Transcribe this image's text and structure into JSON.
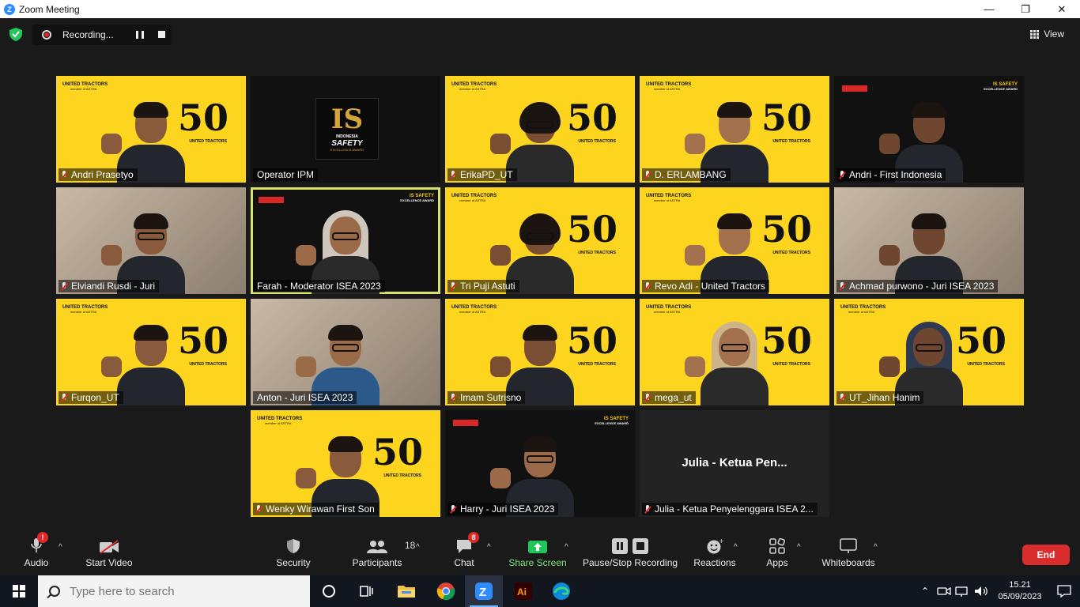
{
  "window": {
    "title": "Zoom Meeting",
    "minimize": "—",
    "maximize": "❐",
    "close": "✕"
  },
  "meeting": {
    "recording_status": "Recording...",
    "view_label": "View"
  },
  "tiles": [
    {
      "name": "Andri Prasetyo",
      "bg": "yellow",
      "muted": true
    },
    {
      "name": "Operator IPM",
      "bg": "dark",
      "muted": false
    },
    {
      "name": "ErikaPD_UT",
      "bg": "yellow",
      "muted": true
    },
    {
      "name": "D. ERLAMBANG",
      "bg": "yellow",
      "muted": true
    },
    {
      "name": "Andri - First Indonesia",
      "bg": "dark",
      "muted": true
    },
    {
      "name": "Elviandi Rusdi - Juri",
      "bg": "photo",
      "muted": true
    },
    {
      "name": "Farah - Moderator ISEA 2023",
      "bg": "dark",
      "muted": false,
      "active": true
    },
    {
      "name": "Tri Puji Astuti",
      "bg": "yellow",
      "muted": true
    },
    {
      "name": "Revo Adi - United Tractors",
      "bg": "yellow",
      "muted": true
    },
    {
      "name": "Achmad purwono - Juri ISEA 2023",
      "bg": "photo",
      "muted": true
    },
    {
      "name": "Furqon_UT",
      "bg": "yellow",
      "muted": true
    },
    {
      "name": "Anton - Juri ISEA 2023",
      "bg": "photo",
      "muted": false
    },
    {
      "name": "Imam Sutrisno",
      "bg": "yellow",
      "muted": true
    },
    {
      "name": "mega_ut",
      "bg": "yellow",
      "muted": true
    },
    {
      "name": "UT_Jihan Hanim",
      "bg": "yellow",
      "muted": true
    },
    {
      "name": "Wenky Wirawan First Son",
      "bg": "yellow",
      "muted": true
    },
    {
      "name": "Harry - Juri ISEA 2023",
      "bg": "dark",
      "muted": true
    },
    {
      "name": "Julia - Ketua Penyelenggara ISEA 2...",
      "bg": "empty",
      "muted": true,
      "display_name": "Julia - Ketua Pen..."
    }
  ],
  "branding": {
    "ut_logo": "UNITED TRACTORS",
    "ut_sub": "member of ASTRA",
    "fifty": "50",
    "fifty_sub": "UNITED TRACTORS",
    "isea_big": "IS",
    "isea_line1": "INDONESIA",
    "isea_line2": "SAFETY",
    "isea_line3": "EXCELLENCE AWARD"
  },
  "toolbar": {
    "audio": "Audio",
    "video": "Start Video",
    "security": "Security",
    "participants": "Participants",
    "participants_count": "18",
    "chat": "Chat",
    "chat_badge": "8",
    "audio_badge": "!",
    "share": "Share Screen",
    "recording": "Pause/Stop Recording",
    "reactions": "Reactions",
    "apps": "Apps",
    "whiteboards": "Whiteboards",
    "end": "End"
  },
  "taskbar": {
    "search_placeholder": "Type here to search",
    "time": "15.21",
    "date": "05/09/2023"
  },
  "colors": {
    "accent_green": "#7ee07e",
    "end_red": "#d92c2c",
    "ut_yellow": "#fdd51f",
    "active_outline": "#d7e36a"
  }
}
